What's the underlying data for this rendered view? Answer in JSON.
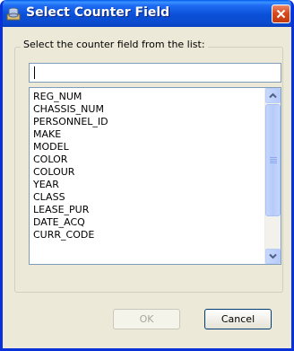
{
  "window": {
    "title": "Select Counter Field",
    "title_icon": "database-folder-icon",
    "close_icon": "close-icon"
  },
  "group": {
    "legend": "Select the counter field from the list:"
  },
  "search": {
    "value": ""
  },
  "list": {
    "items": [
      "REG_NUM",
      "CHASSIS_NUM",
      "PERSONNEL_ID",
      "MAKE",
      "MODEL",
      "COLOR",
      "COLOUR",
      "YEAR",
      "CLASS",
      "LEASE_PUR",
      "DATE_ACQ",
      "CURR_CODE"
    ]
  },
  "buttons": {
    "ok": "OK",
    "cancel": "Cancel"
  },
  "colors": {
    "titlebar": "#0a4fd7",
    "dialog_bg": "#ece9d8",
    "close_button": "#d94a1e",
    "field_border": "#7f9db9"
  }
}
